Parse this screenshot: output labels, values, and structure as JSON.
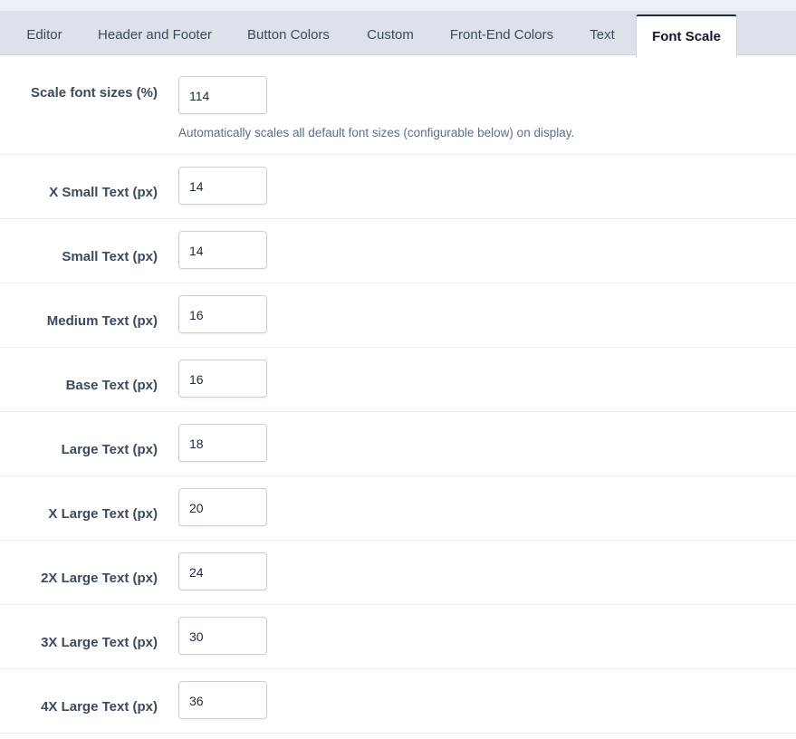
{
  "tabs": [
    {
      "label": "Editor",
      "active": false
    },
    {
      "label": "Header and Footer",
      "active": false
    },
    {
      "label": "Button Colors",
      "active": false
    },
    {
      "label": "Custom",
      "active": false
    },
    {
      "label": "Front-End Colors",
      "active": false
    },
    {
      "label": "Text",
      "active": false
    },
    {
      "label": "Font Scale",
      "active": true
    }
  ],
  "settings": {
    "scale": {
      "label": "Scale font sizes (%)",
      "value": "114",
      "description": "Automatically scales all default font sizes (configurable below) on display."
    },
    "xsmall": {
      "label": "X Small Text (px)",
      "value": "14"
    },
    "small": {
      "label": "Small Text (px)",
      "value": "14"
    },
    "medium": {
      "label": "Medium Text (px)",
      "value": "16"
    },
    "base": {
      "label": "Base Text (px)",
      "value": "16"
    },
    "large": {
      "label": "Large Text (px)",
      "value": "18"
    },
    "xlarge": {
      "label": "X Large Text (px)",
      "value": "20"
    },
    "x2large": {
      "label": "2X Large Text (px)",
      "value": "24"
    },
    "x3large": {
      "label": "3X Large Text (px)",
      "value": "30"
    },
    "x4large": {
      "label": "4X Large Text (px)",
      "value": "36"
    }
  }
}
